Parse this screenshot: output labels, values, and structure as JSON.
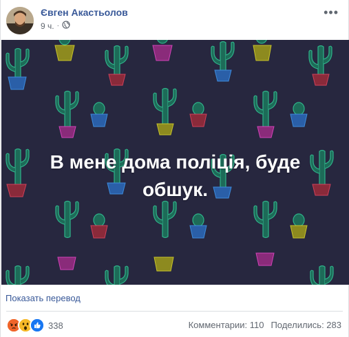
{
  "post": {
    "author": "Євген Акастьолов",
    "time": "9 ч.",
    "separator": "·",
    "audience_icon": "globe-icon",
    "more_icon": "more-icon",
    "caption": "В мене дома поліція, буде обшук.",
    "translate_link": "Показать перевод"
  },
  "footer": {
    "reactions": [
      "angry",
      "wow",
      "like"
    ],
    "reactions_count": "338",
    "comments": "Комментарии: 110",
    "shares": "Поделились: 283"
  },
  "colors": {
    "link": "#385898",
    "image_bg": "#27273f",
    "caption_text": "#ffffff"
  }
}
